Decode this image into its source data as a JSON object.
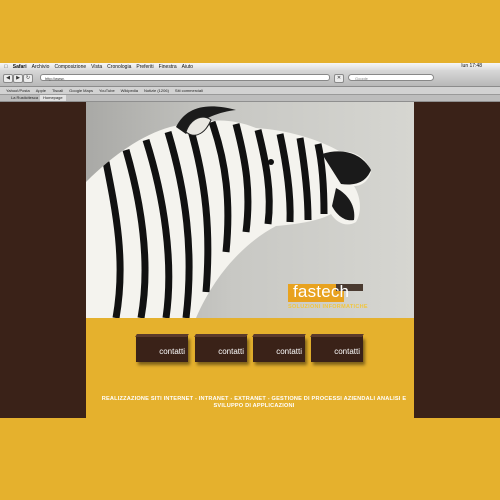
{
  "menubar": {
    "app": "Safari",
    "items": [
      "Archivio",
      "Composizione",
      "Vista",
      "Cronologia",
      "Preferiti",
      "Finestra",
      "Aiuto"
    ],
    "clock": "lun 17:48"
  },
  "browser": {
    "url": "http://www.",
    "search_placeholder": "Google",
    "bookmarks": [
      "Yahoo!/Posta",
      "Apple",
      "Tiscali",
      "Google Maps",
      "YouTube",
      "Wikipedia",
      "Notizie (1206)",
      "Siti commerciali"
    ],
    "tabs": [
      "La Rusticitesca",
      "Homepage"
    ]
  },
  "logo": {
    "name": "fastech",
    "tagline": "SOLUZIONI INFORMATICHE"
  },
  "buttons": [
    {
      "label": "contatti"
    },
    {
      "label": "contatti"
    },
    {
      "label": "contatti"
    },
    {
      "label": "contatti"
    }
  ],
  "footer": "REALIZZAZIONE SITI INTERNET - INTRANET - EXTRANET - GESTIONE DI PROCESSI AZIENDALI ANALISI E SVILUPPO DI APPLICAZIONI",
  "colors": {
    "background": "#e5b12d",
    "brown": "#3a2218",
    "accent": "#e8a21f"
  },
  "photo": {
    "subject": "zebra"
  }
}
